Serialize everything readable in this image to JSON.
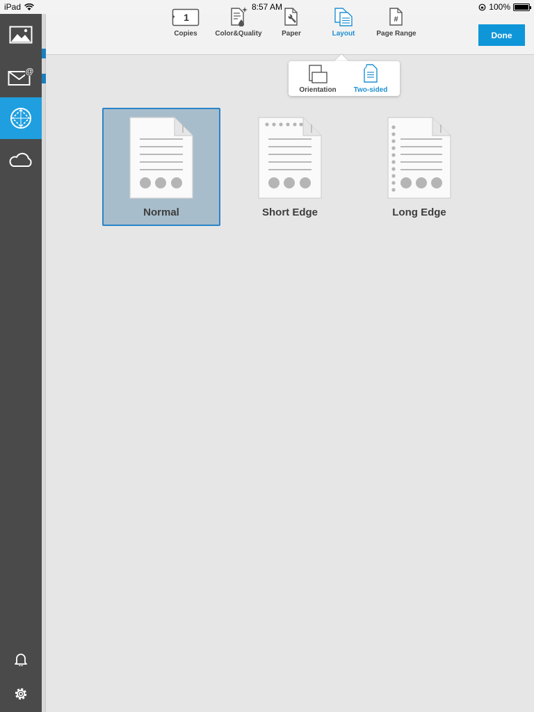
{
  "status_bar": {
    "device": "iPad",
    "time": "8:57 AM",
    "battery": "100%",
    "battery_level": 1.0
  },
  "sidebar": {
    "items": [
      {
        "name": "photos",
        "icon": "image-icon"
      },
      {
        "name": "email",
        "icon": "email-at-icon"
      },
      {
        "name": "print",
        "icon": "print-target-icon",
        "active": true
      },
      {
        "name": "cloud",
        "icon": "cloud-icon"
      }
    ],
    "bottom": [
      {
        "name": "notifications",
        "icon": "bell-icon"
      },
      {
        "name": "settings",
        "icon": "gear-icon"
      }
    ]
  },
  "toolbar": {
    "copies_value": "1",
    "tabs": [
      {
        "label": "Copies"
      },
      {
        "label": "Color&Quality"
      },
      {
        "label": "Paper"
      },
      {
        "label": "Layout",
        "active": true
      },
      {
        "label": "Page Range"
      }
    ],
    "done_label": "Done",
    "page_range_glyph": "#"
  },
  "popover": {
    "items": [
      {
        "label": "Orientation"
      },
      {
        "label": "Two-sided",
        "active": true
      }
    ]
  },
  "options": [
    {
      "label": "Normal",
      "selected": true
    },
    {
      "label": "Short Edge"
    },
    {
      "label": "Long Edge"
    }
  ],
  "colors": {
    "accent": "#1f9fdf",
    "done": "#0f96d9",
    "sidebar": "#4a4a4a",
    "selected_bg": "#a8bdcb",
    "selected_border": "#2a83c8"
  }
}
